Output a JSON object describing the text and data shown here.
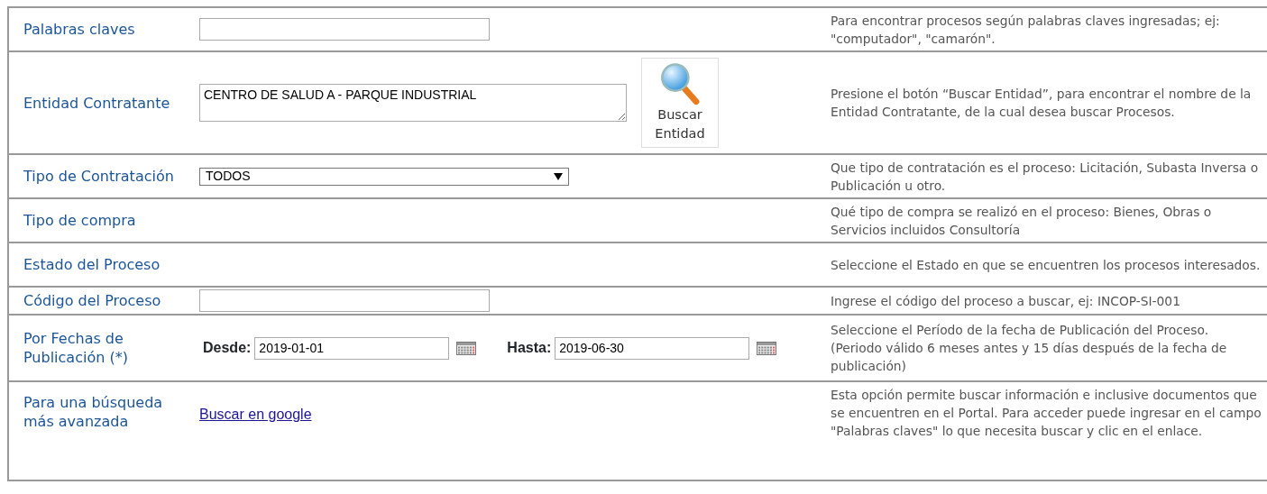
{
  "rows": [
    {
      "kind": "text",
      "label": "Palabras claves",
      "value": "",
      "description": "Para encontrar procesos según palabras claves ingresadas; ej: \"computador\", \"camarón\"."
    },
    {
      "kind": "entity",
      "label": "Entidad Contratante",
      "value": "CENTRO DE SALUD A - PARQUE INDUSTRIAL",
      "button": "Buscar Entidad",
      "description": "Presione el botón “Buscar Entidad”, para encontrar el nombre de la Entidad Contratante, de la cual desea buscar Procesos."
    },
    {
      "kind": "select",
      "label": "Tipo de Contratación",
      "value": "TODOS",
      "description": "Que tipo de contratación es el proceso: Licitación, Subasta Inversa o Publicación u otro."
    },
    {
      "kind": "none",
      "label": "Tipo de compra",
      "description": "Qué tipo de compra se realizó en el proceso: Bienes, Obras o Servicios incluidos Consultoría"
    },
    {
      "kind": "none",
      "label": "Estado del Proceso",
      "description": "Seleccione el Estado en que se encuentren los procesos interesados."
    },
    {
      "kind": "text",
      "label": "Código del Proceso",
      "value": "",
      "description": "Ingrese el código del proceso a buscar, ej: INCOP-SI-001"
    },
    {
      "kind": "daterange",
      "label": "Por Fechas de Publicación (*)",
      "from_label": "Desde:",
      "from": "2019-01-01",
      "to_label": "Hasta:",
      "to": "2019-06-30",
      "description": "Seleccione el Período de la fecha de Publicación del Proceso.\n(Periodo válido 6 meses antes y 15 días después de la fecha de publicación)"
    },
    {
      "kind": "link",
      "label": "Para una búsqueda más avanzada",
      "link": "Buscar en google",
      "description": "Esta opción permite buscar información e inclusive documentos que se encuentren en el Portal. Para acceder puede ingresar en el campo \"Palabras claves\" lo que necesita buscar y clic en el enlace."
    }
  ]
}
